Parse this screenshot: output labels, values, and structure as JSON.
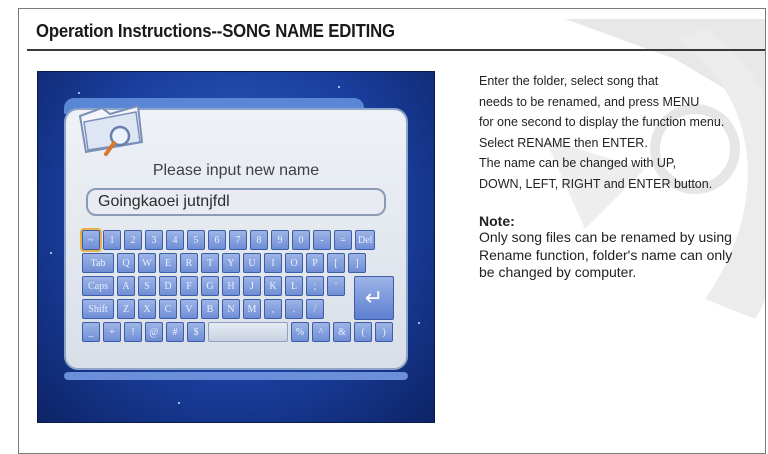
{
  "title": "Operation Instructions--SONG NAME EDITING",
  "screen": {
    "prompt": "Please input new name",
    "name_value": "Goingkaoei jutnjfdl",
    "keyboard": {
      "row1": [
        "~",
        "1",
        "2",
        "3",
        "4",
        "5",
        "6",
        "7",
        "8",
        "9",
        "0",
        "-",
        "=",
        "Del"
      ],
      "row2": [
        "Tab",
        "Q",
        "W",
        "E",
        "R",
        "T",
        "Y",
        "U",
        "I",
        "O",
        "P",
        "[",
        "]"
      ],
      "row3": [
        "Caps",
        "A",
        "S",
        "D",
        "F",
        "G",
        "H",
        "J",
        "K",
        "L",
        ";",
        "'"
      ],
      "row4": [
        "Shift",
        "Z",
        "X",
        "C",
        "V",
        "B",
        "N",
        "M",
        ",",
        ".",
        "/"
      ],
      "row5": [
        "_",
        "+",
        "!",
        "@",
        "#",
        "$",
        "",
        "%",
        "^",
        "&",
        "(",
        ")"
      ],
      "enter": "↵"
    }
  },
  "instructions": {
    "line1": "Enter the folder, select song that",
    "line2": "needs to be renamed, and press MENU",
    "line3": "for one second to display  the function menu.",
    "line4": "Select RENAME then ENTER.",
    "line5": "The name can be changed  with UP,",
    "line6": "DOWN, LEFT, RIGHT and ENTER button."
  },
  "note": {
    "title": "Note:",
    "body": "Only song files can be renamed by using Rename function, folder's name can only be changed by computer."
  }
}
